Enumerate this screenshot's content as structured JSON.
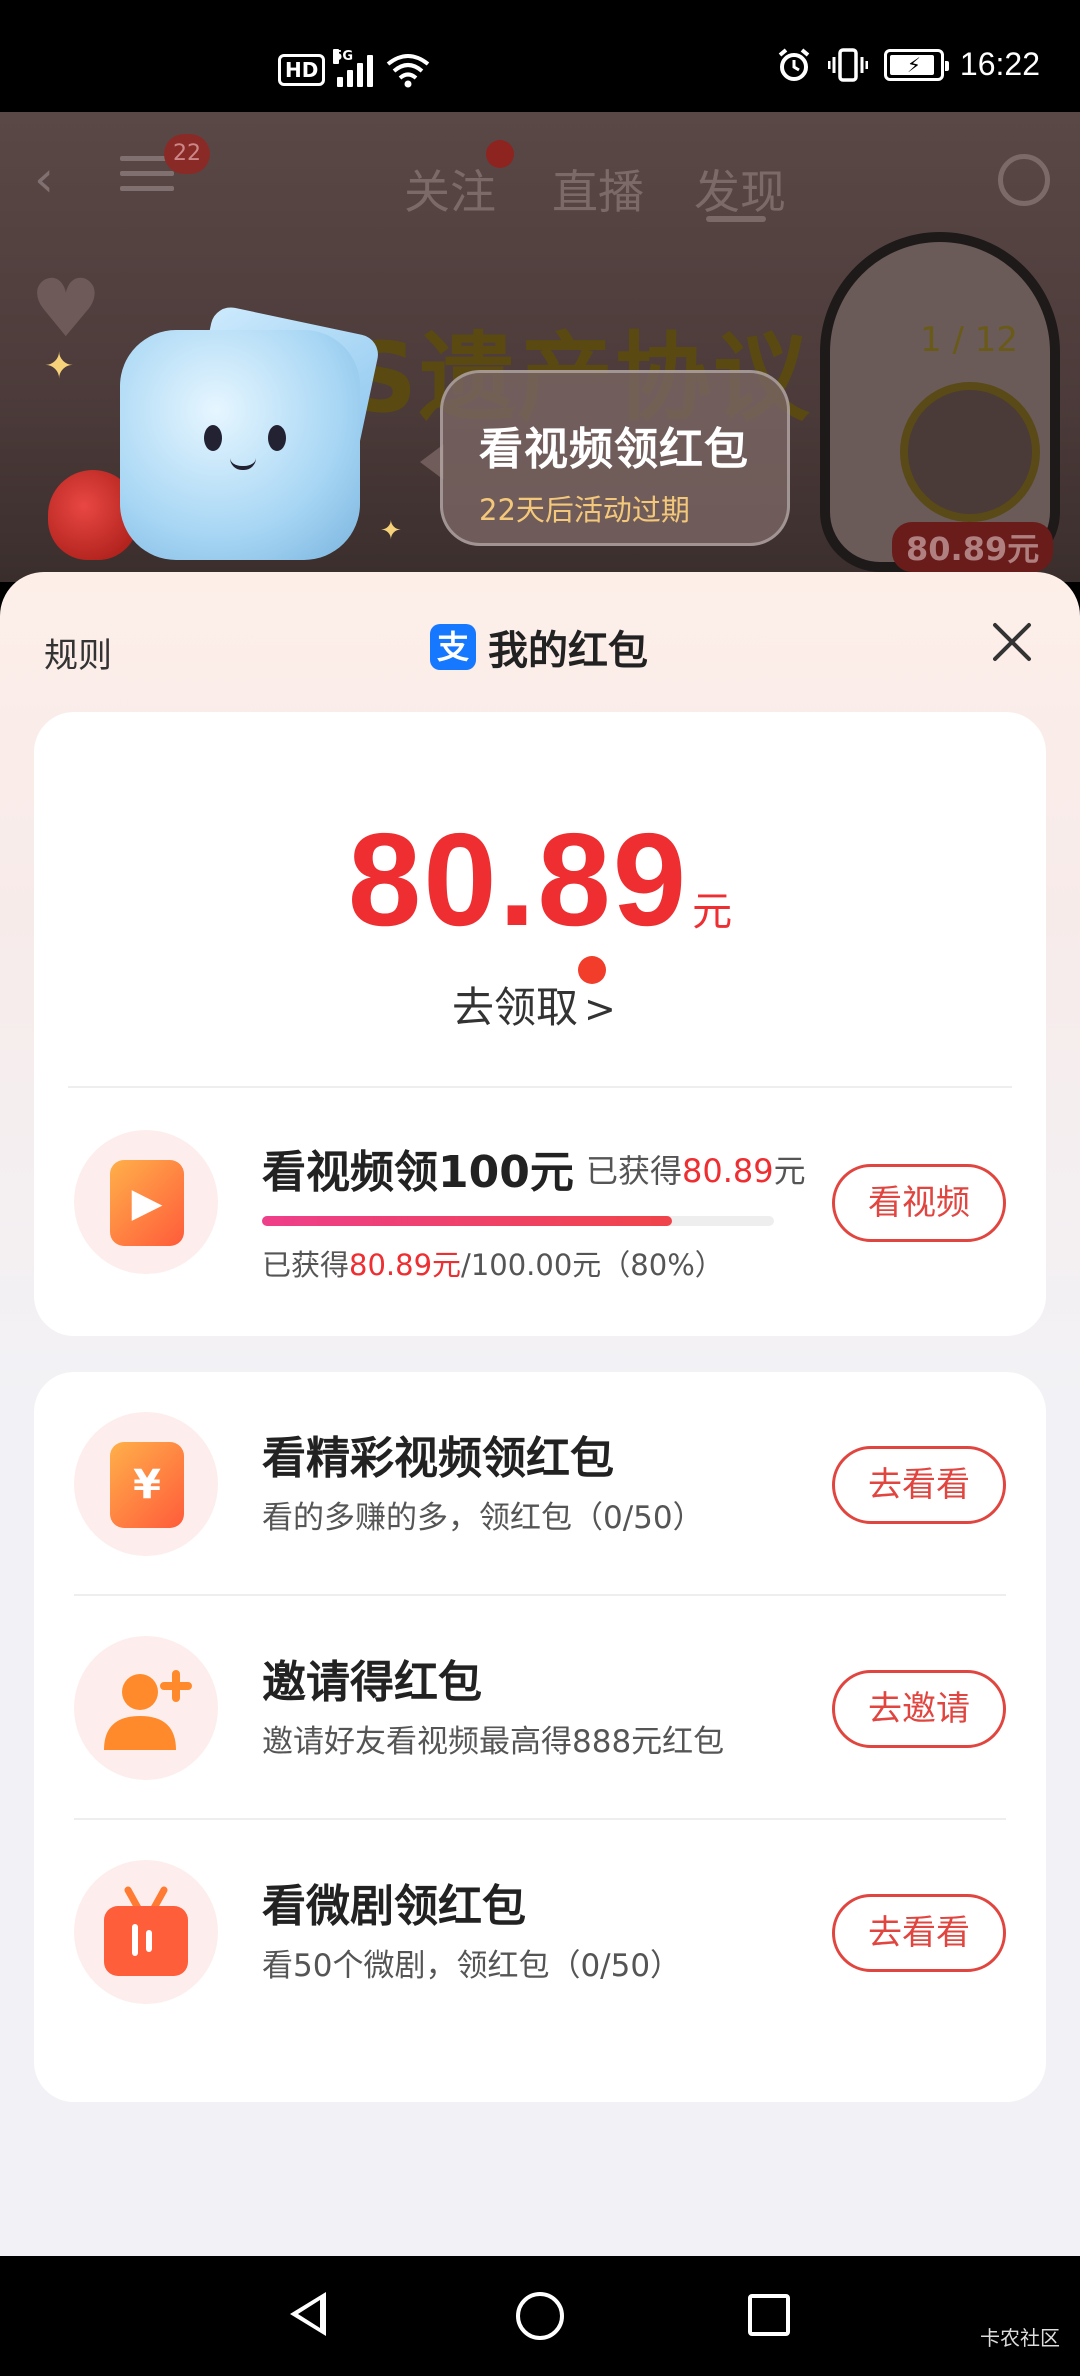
{
  "status_bar": {
    "hd_label": "HD",
    "network_label": "5G",
    "time": "16:22",
    "icons": [
      "signal-icon",
      "wifi-icon",
      "alarm-icon",
      "vibrate-icon",
      "battery-charging-icon"
    ]
  },
  "background_app": {
    "tabs": [
      "关注",
      "直播",
      "发现"
    ],
    "notification_count": "22",
    "banner_title": "大S遗产协议",
    "page_counter": "1 / 12",
    "floating_amount": "80.89元"
  },
  "promo_bubble": {
    "title": "看视频领红包",
    "subtitle": "22天后活动过期"
  },
  "sheet": {
    "rules_label": "规则",
    "title": "我的红包",
    "alipay_icon_char": "支"
  },
  "balance": {
    "amount": "80.89",
    "unit": "元",
    "claim_label": "去领取",
    "claim_arrow": ">"
  },
  "main_task": {
    "title": "看视频领100元",
    "earned_prefix": "已获得",
    "earned_value": "80.89",
    "earned_unit": "元",
    "progress_prefix": "已获得",
    "progress_earned": "80.89元",
    "progress_rest": "/100.00元（80%）",
    "progress_fraction": 0.8,
    "button_label": "看视频"
  },
  "tasks": [
    {
      "title": "看精彩视频领红包",
      "subtitle": "看的多赚的多，领红包（0/50）",
      "button_label": "去看看",
      "icon": "yuan-envelope-icon",
      "icon_char": "¥"
    },
    {
      "title": "邀请得红包",
      "subtitle": "邀请好友看视频最高得888元红包",
      "button_label": "去邀请",
      "icon": "add-friend-icon",
      "icon_char": ""
    },
    {
      "title": "看微剧领红包",
      "subtitle": "看50个微剧，领红包（0/50）",
      "button_label": "去看看",
      "icon": "tv-icon",
      "icon_char": ""
    }
  ],
  "watermark": "卡农社区",
  "colors": {
    "accent_red": "#ee2e31",
    "button_border": "#e0453f",
    "alipay_blue": "#1677ff"
  }
}
